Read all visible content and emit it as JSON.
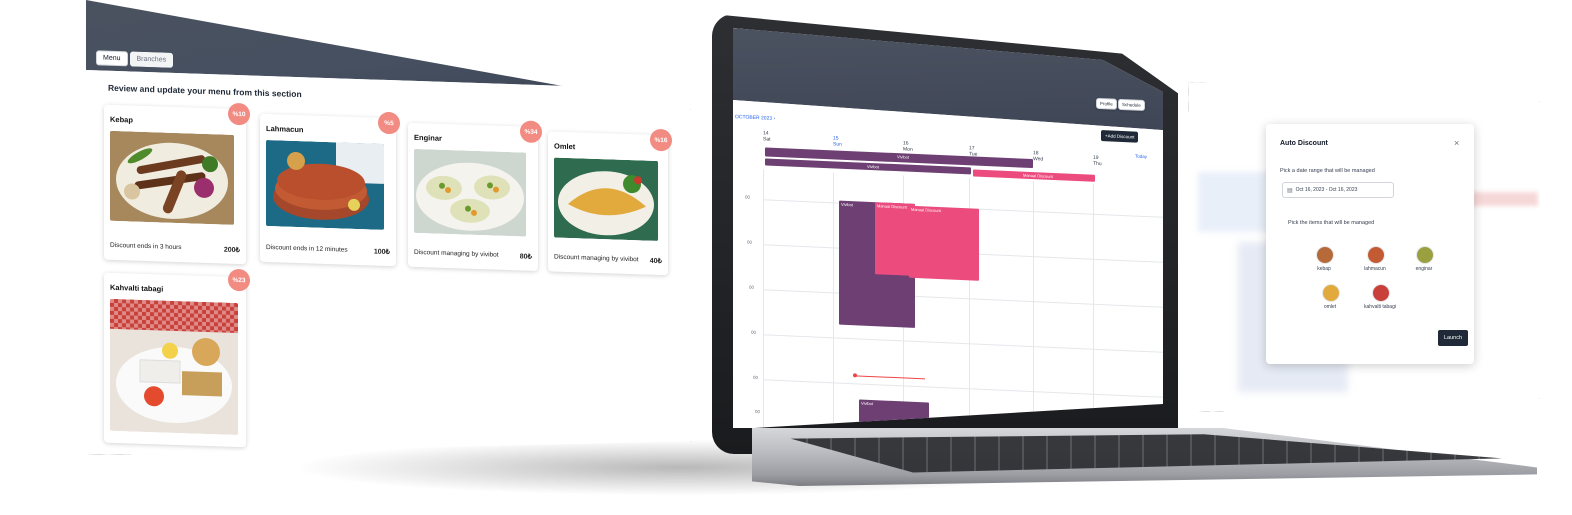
{
  "menu_panel": {
    "header_buttons": {
      "profile": "Profile",
      "schedule": "Schedule"
    },
    "tabs": [
      {
        "label": "Menu",
        "active": true
      },
      {
        "label": "Branches",
        "active": false
      }
    ],
    "title": "Review and update your menu from this section",
    "items": [
      {
        "name": "Kebap",
        "discount": "%10",
        "note": "Discount ends in 3 hours",
        "price": "200₺"
      },
      {
        "name": "Lahmacun",
        "discount": "%5",
        "note": "Discount ends in 12 minutes",
        "price": "100₺"
      },
      {
        "name": "Enginar",
        "discount": "%34",
        "note": "Discount managing by vivibot",
        "price": "80₺"
      },
      {
        "name": "Omlet",
        "discount": "%16",
        "note": "Discount managing by vivibot",
        "price": "40₺"
      },
      {
        "name": "Kahvalti tabagi",
        "discount": "%23"
      }
    ]
  },
  "laptop": {
    "header_buttons": {
      "profile": "Profile",
      "schedule": "Schedule"
    },
    "month_label": "OCTOBER 2023",
    "add_discount": "+Add Discount",
    "today": "Today",
    "days": [
      {
        "num": "14",
        "name": "Sat"
      },
      {
        "num": "15",
        "name": "Sun"
      },
      {
        "num": "16",
        "name": "Mon"
      },
      {
        "num": "17",
        "name": "Tue"
      },
      {
        "num": "18",
        "name": "Wed"
      },
      {
        "num": "19",
        "name": "Thu"
      }
    ],
    "times": [
      "00",
      "00",
      "00",
      "00",
      "00",
      "00"
    ],
    "events": {
      "vivibot": "Vivibot",
      "manual": "Manual Discount"
    }
  },
  "auto_discount": {
    "title": "Auto Discount",
    "close": "×",
    "range_label": "Pick a date range that will be managed",
    "range_value": "Oct 16, 2023 - Oct 16, 2023",
    "items_label": "Pick the items that will be managed",
    "items": [
      "kebap",
      "lahmacun",
      "enginar",
      "omlet",
      "kahvalti tabagi"
    ],
    "launch": "Launch"
  },
  "colors": {
    "header": "#464e5c",
    "badge": "#f28b82",
    "purple": "#6d3f73",
    "pink": "#ec4b7e"
  }
}
